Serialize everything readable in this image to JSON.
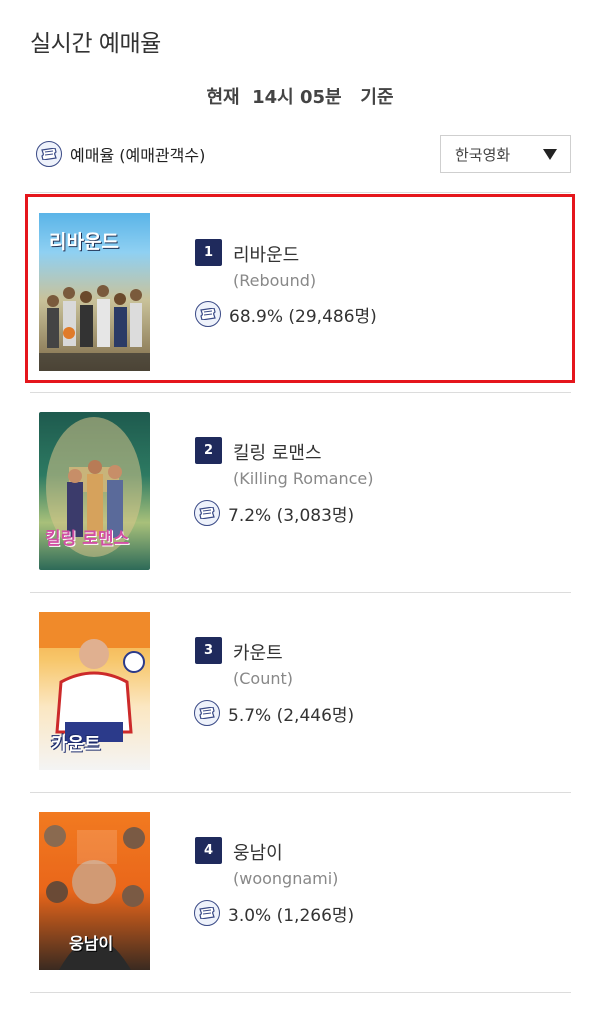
{
  "page_title": "실시간 예매율",
  "time_line": "현재  14시 05분   기준",
  "legend": {
    "label": "예매율 (예매관객수)",
    "icon": "ticket-icon"
  },
  "filter": {
    "selected": "한국영화",
    "icon": "triangle-down-icon"
  },
  "colors": {
    "highlight": "#e5161c",
    "badge": "#1f2a5c"
  },
  "movies": [
    {
      "rank": "1",
      "title_ko": "리바운드",
      "title_en": "(Rebound)",
      "rate": "68.9% (29,486명)",
      "poster_text": "리바운드"
    },
    {
      "rank": "2",
      "title_ko": "킬링 로맨스",
      "title_en": "(Killing Romance)",
      "rate": "7.2% (3,083명)",
      "poster_text": "킬링 로맨스"
    },
    {
      "rank": "3",
      "title_ko": "카운트",
      "title_en": "(Count)",
      "rate": "5.7% (2,446명)",
      "poster_text": "카운트"
    },
    {
      "rank": "4",
      "title_ko": "웅남이",
      "title_en": "(woongnami)",
      "rate": "3.0% (1,266명)",
      "poster_text": "웅남이"
    }
  ]
}
